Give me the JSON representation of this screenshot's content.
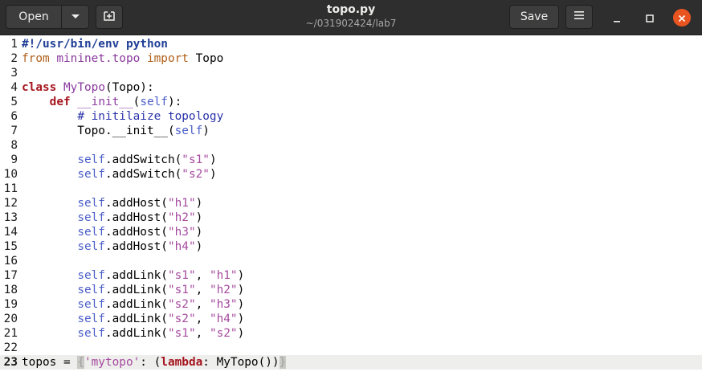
{
  "window": {
    "title": "topo.py",
    "subtitle": "~/031902424/lab7"
  },
  "header": {
    "open_label": "Open",
    "save_label": "Save"
  },
  "icons": {
    "open_menu": "chevron-down-icon",
    "new_tab": "new-tab-icon",
    "menu": "hamburger-menu-icon",
    "minimize": "minimize-icon",
    "maximize": "maximize-icon",
    "close": "close-icon"
  },
  "colors": {
    "header_bg": "#2e2e2e",
    "close_accent": "#e95420",
    "keyword": "#a5151f",
    "string": "#a54b9e",
    "self": "#4a5dc9",
    "comment": "#2a33a8"
  },
  "editor": {
    "current_line": 23,
    "lines": [
      {
        "n": "1",
        "tokens": [
          {
            "t": "#!/usr/bin/env python",
            "c": "shebang"
          }
        ]
      },
      {
        "n": "2",
        "tokens": [
          {
            "t": "from",
            "c": "pre"
          },
          {
            "t": " ",
            "c": ""
          },
          {
            "t": "mininet.topo",
            "c": "mod"
          },
          {
            "t": " ",
            "c": ""
          },
          {
            "t": "import",
            "c": "pre"
          },
          {
            "t": " Topo",
            "c": ""
          }
        ]
      },
      {
        "n": "3",
        "tokens": []
      },
      {
        "n": "4",
        "tokens": [
          {
            "t": "class",
            "c": "kw"
          },
          {
            "t": " ",
            "c": ""
          },
          {
            "t": "MyTopo",
            "c": "mod"
          },
          {
            "t": "(Topo):",
            "c": ""
          }
        ]
      },
      {
        "n": "5",
        "tokens": [
          {
            "t": "    ",
            "c": ""
          },
          {
            "t": "def",
            "c": "kw"
          },
          {
            "t": " ",
            "c": ""
          },
          {
            "t": "__init__",
            "c": "mod"
          },
          {
            "t": "(",
            "c": ""
          },
          {
            "t": "self",
            "c": "self"
          },
          {
            "t": "):",
            "c": ""
          }
        ]
      },
      {
        "n": "6",
        "tokens": [
          {
            "t": "        ",
            "c": ""
          },
          {
            "t": "# initilaize topology",
            "c": "comment"
          }
        ]
      },
      {
        "n": "7",
        "tokens": [
          {
            "t": "        Topo.__init__(",
            "c": ""
          },
          {
            "t": "self",
            "c": "self"
          },
          {
            "t": ")",
            "c": ""
          }
        ]
      },
      {
        "n": "8",
        "tokens": []
      },
      {
        "n": "9",
        "tokens": [
          {
            "t": "        ",
            "c": ""
          },
          {
            "t": "self",
            "c": "self"
          },
          {
            "t": ".addSwitch(",
            "c": ""
          },
          {
            "t": "\"s1\"",
            "c": "str"
          },
          {
            "t": ")",
            "c": ""
          }
        ]
      },
      {
        "n": "10",
        "tokens": [
          {
            "t": "        ",
            "c": ""
          },
          {
            "t": "self",
            "c": "self"
          },
          {
            "t": ".addSwitch(",
            "c": ""
          },
          {
            "t": "\"s2\"",
            "c": "str"
          },
          {
            "t": ")",
            "c": ""
          }
        ]
      },
      {
        "n": "11",
        "tokens": []
      },
      {
        "n": "12",
        "tokens": [
          {
            "t": "        ",
            "c": ""
          },
          {
            "t": "self",
            "c": "self"
          },
          {
            "t": ".addHost(",
            "c": ""
          },
          {
            "t": "\"h1\"",
            "c": "str"
          },
          {
            "t": ")",
            "c": ""
          }
        ]
      },
      {
        "n": "13",
        "tokens": [
          {
            "t": "        ",
            "c": ""
          },
          {
            "t": "self",
            "c": "self"
          },
          {
            "t": ".addHost(",
            "c": ""
          },
          {
            "t": "\"h2\"",
            "c": "str"
          },
          {
            "t": ")",
            "c": ""
          }
        ]
      },
      {
        "n": "14",
        "tokens": [
          {
            "t": "        ",
            "c": ""
          },
          {
            "t": "self",
            "c": "self"
          },
          {
            "t": ".addHost(",
            "c": ""
          },
          {
            "t": "\"h3\"",
            "c": "str"
          },
          {
            "t": ")",
            "c": ""
          }
        ]
      },
      {
        "n": "15",
        "tokens": [
          {
            "t": "        ",
            "c": ""
          },
          {
            "t": "self",
            "c": "self"
          },
          {
            "t": ".addHost(",
            "c": ""
          },
          {
            "t": "\"h4\"",
            "c": "str"
          },
          {
            "t": ")",
            "c": ""
          }
        ]
      },
      {
        "n": "16",
        "tokens": []
      },
      {
        "n": "17",
        "tokens": [
          {
            "t": "        ",
            "c": ""
          },
          {
            "t": "self",
            "c": "self"
          },
          {
            "t": ".addLink(",
            "c": ""
          },
          {
            "t": "\"s1\"",
            "c": "str"
          },
          {
            "t": ", ",
            "c": ""
          },
          {
            "t": "\"h1\"",
            "c": "str"
          },
          {
            "t": ")",
            "c": ""
          }
        ]
      },
      {
        "n": "18",
        "tokens": [
          {
            "t": "        ",
            "c": ""
          },
          {
            "t": "self",
            "c": "self"
          },
          {
            "t": ".addLink(",
            "c": ""
          },
          {
            "t": "\"s1\"",
            "c": "str"
          },
          {
            "t": ", ",
            "c": ""
          },
          {
            "t": "\"h2\"",
            "c": "str"
          },
          {
            "t": ")",
            "c": ""
          }
        ]
      },
      {
        "n": "19",
        "tokens": [
          {
            "t": "        ",
            "c": ""
          },
          {
            "t": "self",
            "c": "self"
          },
          {
            "t": ".addLink(",
            "c": ""
          },
          {
            "t": "\"s2\"",
            "c": "str"
          },
          {
            "t": ", ",
            "c": ""
          },
          {
            "t": "\"h3\"",
            "c": "str"
          },
          {
            "t": ")",
            "c": ""
          }
        ]
      },
      {
        "n": "20",
        "tokens": [
          {
            "t": "        ",
            "c": ""
          },
          {
            "t": "self",
            "c": "self"
          },
          {
            "t": ".addLink(",
            "c": ""
          },
          {
            "t": "\"s2\"",
            "c": "str"
          },
          {
            "t": ", ",
            "c": ""
          },
          {
            "t": "\"h4\"",
            "c": "str"
          },
          {
            "t": ")",
            "c": ""
          }
        ]
      },
      {
        "n": "21",
        "tokens": [
          {
            "t": "        ",
            "c": ""
          },
          {
            "t": "self",
            "c": "self"
          },
          {
            "t": ".addLink(",
            "c": ""
          },
          {
            "t": "\"s1\"",
            "c": "str"
          },
          {
            "t": ", ",
            "c": ""
          },
          {
            "t": "\"s2\"",
            "c": "str"
          },
          {
            "t": ")",
            "c": ""
          }
        ]
      },
      {
        "n": "22",
        "tokens": []
      },
      {
        "n": "23",
        "tokens": [
          {
            "t": "topos = ",
            "c": ""
          },
          {
            "t": "{",
            "c": "bracket"
          },
          {
            "t": "'mytopo'",
            "c": "str"
          },
          {
            "t": ": (",
            "c": ""
          },
          {
            "t": "lambda",
            "c": "kw"
          },
          {
            "t": ": MyTopo())",
            "c": ""
          },
          {
            "t": "}",
            "c": "bracket"
          }
        ]
      }
    ]
  }
}
